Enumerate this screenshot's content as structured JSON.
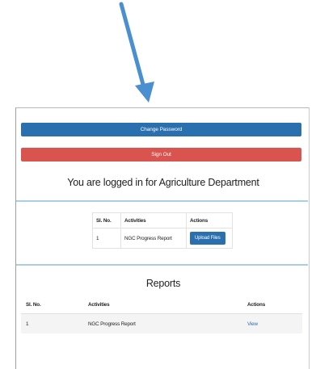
{
  "account": {
    "change_password_label": "Change Password",
    "sign_out_label": "Sign Out",
    "logged_in_text": "You are logged in for Agriculture Department"
  },
  "activities_table": {
    "headers": [
      "Sl. No.",
      "Activities",
      "Actions"
    ],
    "rows": [
      {
        "sl_no": "1",
        "activity": "NGC Progress Report",
        "action_label": "Upload Files"
      }
    ]
  },
  "reports": {
    "title": "Reports",
    "headers": [
      "Sl. No.",
      "Activities",
      "Actions"
    ],
    "rows": [
      {
        "sl_no": "1",
        "activity": "NGC Progress Report",
        "action_label": "View"
      }
    ]
  },
  "colors": {
    "primary": "#2a70af",
    "danger": "#d9534f",
    "divider": "#a9cfe2",
    "annotation_arrow": "#4a8fd0"
  },
  "annotation": {
    "icon": "arrow-down-right-icon"
  }
}
